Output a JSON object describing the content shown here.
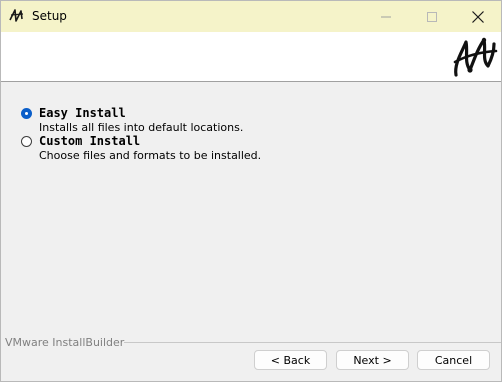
{
  "window": {
    "title": "Setup"
  },
  "options": [
    {
      "label": "Easy Install",
      "description": "Installs all files into default locations.",
      "selected": true
    },
    {
      "label": "Custom Install",
      "description": "Choose files and formats to be installed.",
      "selected": false
    }
  ],
  "footer": {
    "brand": "VMware InstallBuilder",
    "back_label": "< Back",
    "next_label": "Next >",
    "cancel_label": "Cancel"
  },
  "colors": {
    "titlebar_bg": "#f5f3c9",
    "accent": "#0a5ec9",
    "window_bg": "#f0f0f0"
  },
  "icons": {
    "app": "installbuilder-logo-icon",
    "minimize": "minimize-icon",
    "maximize": "maximize-icon",
    "close": "close-icon",
    "brand": "installbuilder-logo"
  }
}
